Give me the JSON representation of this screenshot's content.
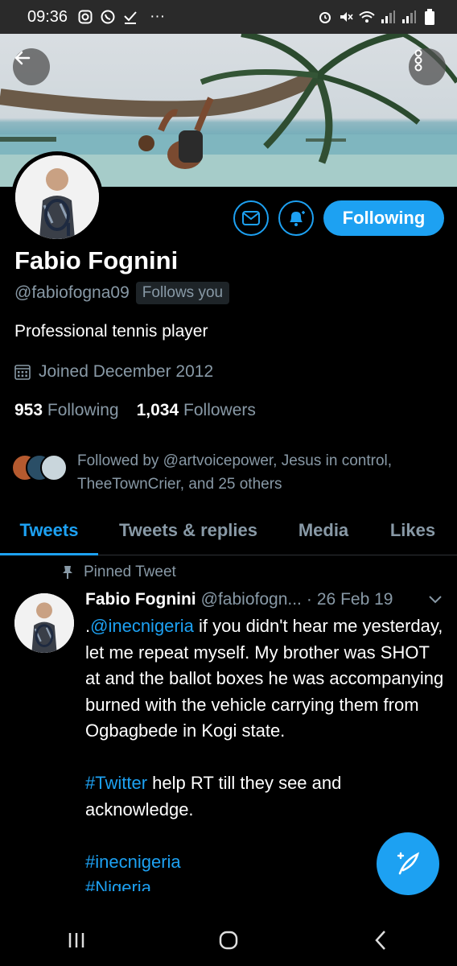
{
  "status_bar": {
    "time": "09:36",
    "overflow": "···"
  },
  "profile": {
    "name": "Fabio Fognini",
    "handle": "@fabiofogna09",
    "follows_you": "Follows you",
    "bio": "Professional tennis player",
    "joined": "Joined December 2012",
    "following_count": "953",
    "following_label": "Following",
    "followers_count": "1,034",
    "followers_label": "Followers",
    "followed_by": "Followed by @artvoicepower, Jesus in control, TheeTownCrier, and 25 others",
    "follow_button_label": "Following"
  },
  "tabs": [
    {
      "label": "Tweets",
      "active": true
    },
    {
      "label": "Tweets & replies",
      "active": false
    },
    {
      "label": "Media",
      "active": false
    },
    {
      "label": "Likes",
      "active": false
    }
  ],
  "tweet": {
    "pinned_label": "Pinned Tweet",
    "author": "Fabio Fognini",
    "handle": "@fabiofogn...",
    "date_sep": "·",
    "date": "26 Feb 19",
    "body_prefix": ".",
    "mention": "@inecnigeria",
    "body_1": " if you didn't hear me yesterday, let me repeat myself. My brother was SHOT at and the ballot boxes he was accompanying burned with the vehicle carrying them from Ogbagbede in Kogi state.",
    "hashtag_1": "#Twitter",
    "body_2": " help RT till they see and acknowledge.",
    "hashtag_2": "#inecnigeria",
    "hashtag_3": "#Nigeria"
  },
  "colors": {
    "accent": "#1da1f2",
    "muted": "#8899a6",
    "background": "#000000"
  },
  "icons": [
    "back-arrow-icon",
    "more-vertical-icon",
    "envelope-icon",
    "bell-plus-icon",
    "calendar-icon",
    "pin-icon",
    "chevron-down-icon",
    "compose-feather-icon",
    "recent-apps-icon",
    "home-icon",
    "back-icon"
  ]
}
